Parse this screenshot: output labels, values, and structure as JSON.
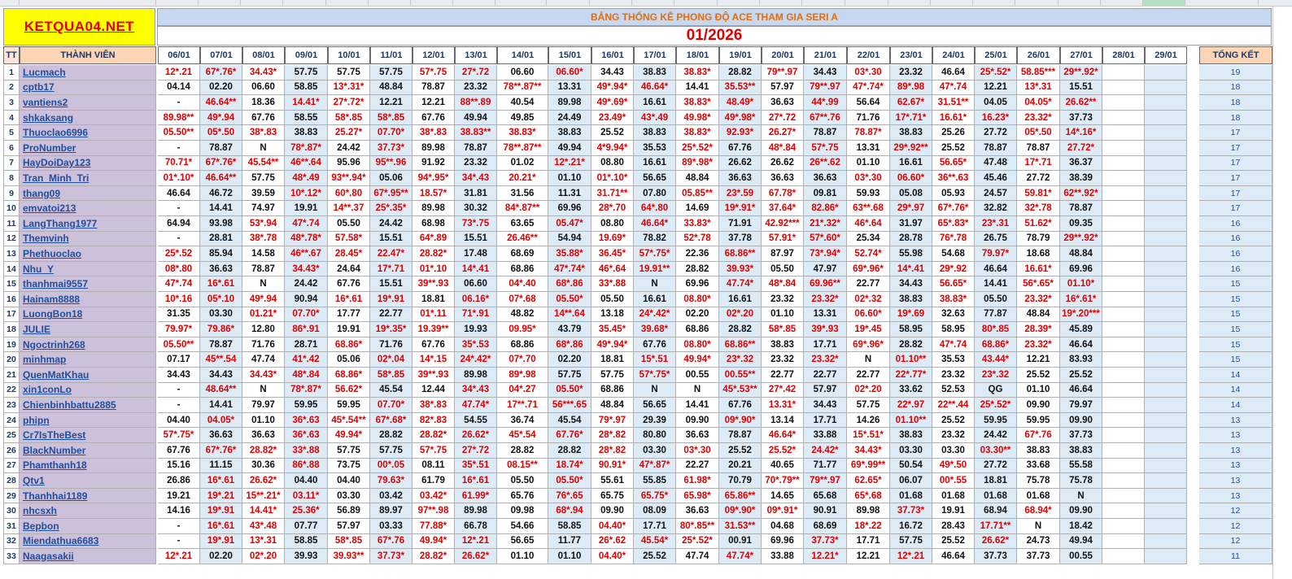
{
  "header": {
    "logo": "KETQUA04.NET",
    "subtitle": "BẢNG THỐNG KÊ PHONG ĐỘ ACE THAM GIA SERI A",
    "month": "01/2026"
  },
  "columns": {
    "tt": "TT",
    "name": "THÀNH VIÊN",
    "total": "TỔNG KẾT",
    "dates": [
      "06/01",
      "07/01",
      "08/01",
      "09/01",
      "10/01",
      "11/01",
      "12/01",
      "13/01",
      "14/01",
      "15/01",
      "16/01",
      "17/01",
      "18/01",
      "19/01",
      "20/01",
      "21/01",
      "22/01",
      "23/01",
      "24/01",
      "25/01",
      "26/01",
      "27/01",
      "28/01",
      "29/01"
    ]
  },
  "rows": [
    {
      "tt": "1",
      "name": "Lucmach",
      "values": [
        "12*.21",
        "67*.76*",
        "34.43*",
        "57.75",
        "57.75",
        "57.75",
        "57*.75",
        "27*.72",
        "06.60",
        "06.60*",
        "34.43",
        "38.83",
        "38.83*",
        "28.82",
        "79**.97",
        "34.43",
        "03*.30",
        "23.32",
        "46.64",
        "25*.52*",
        "58.85***",
        "29**.92*",
        "",
        ""
      ],
      "total": "19"
    },
    {
      "tt": "2",
      "name": "cptb17",
      "values": [
        "04.14",
        "02.20",
        "06.60",
        "58.85",
        "13*.31*",
        "48.84",
        "78.87",
        "23.32",
        "78**.87**",
        "13.31",
        "49*.94*",
        "46.64*",
        "14.41",
        "35.53**",
        "57.97",
        "79**.97",
        "47*.74*",
        "89*.98",
        "47*.74",
        "12.21",
        "13*.31",
        "15.51",
        "",
        ""
      ],
      "total": "18"
    },
    {
      "tt": "3",
      "name": "vantiens2",
      "values": [
        "-",
        "46.64**",
        "18.36",
        "14.41*",
        "27*.72*",
        "12.21",
        "12.21",
        "88**.89",
        "40.54",
        "89.98",
        "49*.69*",
        "16.61",
        "38.83*",
        "48.49*",
        "36.63",
        "44*.99",
        "56.64",
        "62.67*",
        "31.51**",
        "04.05",
        "04.05*",
        "26.62**",
        "",
        ""
      ],
      "total": "18"
    },
    {
      "tt": "4",
      "name": "shkaksang",
      "values": [
        "89.98**",
        "49*.94",
        "67.76",
        "58.55",
        "58*.85",
        "58*.85",
        "67.76",
        "49.94",
        "49.85",
        "24.49",
        "23.49*",
        "43*.49",
        "49.98*",
        "49*.98*",
        "27*.72",
        "67**.76",
        "71.76",
        "17*.71*",
        "16.61*",
        "16.23*",
        "23.32*",
        "37.73",
        "",
        ""
      ],
      "total": "18"
    },
    {
      "tt": "5",
      "name": "Thuoclao6996",
      "values": [
        "05.50**",
        "05*.50",
        "38*.83",
        "38.83",
        "25.27*",
        "07.70*",
        "38*.83",
        "38.83**",
        "38.83*",
        "38.83",
        "25.52",
        "38.83",
        "38.83*",
        "92.93*",
        "26.27*",
        "78.87",
        "78.87*",
        "38.83",
        "25.26",
        "27.72",
        "05*.50",
        "14*.16*",
        "",
        ""
      ],
      "total": "17"
    },
    {
      "tt": "6",
      "name": "ProNumber",
      "values": [
        "-",
        "78.87",
        "N",
        "78*.87*",
        "24.42",
        "37.73*",
        "89.98",
        "78.87",
        "78**.87**",
        "49.94",
        "4*9.94*",
        "35.53",
        "25*.52*",
        "67.76",
        "48*.84",
        "57*.75",
        "13.31",
        "29*.92**",
        "25.52",
        "78.87",
        "78.87",
        "27.72*",
        "",
        ""
      ],
      "total": "17"
    },
    {
      "tt": "7",
      "name": "HayDoiDay123",
      "values": [
        "70.71*",
        "67*.76*",
        "45.54**",
        "46**.64",
        "95.96",
        "95**.96",
        "91.92",
        "23.32",
        "01.02",
        "12*.21*",
        "08.80",
        "16.61",
        "89*.98*",
        "26.62",
        "26.62",
        "26**.62",
        "01.10",
        "16.61",
        "56.65*",
        "47.48",
        "17*.71",
        "36.37",
        "",
        ""
      ],
      "total": "17"
    },
    {
      "tt": "8",
      "name": "Tran_Minh_Tri",
      "values": [
        "01*.10*",
        "46.64**",
        "57.75",
        "48*.49",
        "93**.94*",
        "05.06",
        "94*.95*",
        "34*.43",
        "20.21*",
        "01.10",
        "01*.10*",
        "56.65",
        "48.84",
        "36.63",
        "36.63",
        "36.63",
        "03*.30",
        "06.60*",
        "36**.63",
        "45.46",
        "27.72",
        "38.39",
        "",
        ""
      ],
      "total": "17"
    },
    {
      "tt": "9",
      "name": "thang09",
      "values": [
        "46.64",
        "46.72",
        "39.59",
        "10*.12*",
        "60*.80",
        "67*.95**",
        "18.57*",
        "31.81",
        "31.56",
        "11.31",
        "31.71**",
        "07.80",
        "05.85**",
        "23*.59",
        "67.78*",
        "09.81",
        "59.93",
        "05.08",
        "05.93",
        "24.57",
        "59.81*",
        "62**.92*",
        "",
        ""
      ],
      "total": "17"
    },
    {
      "tt": "10",
      "name": "emvatoi213",
      "values": [
        "-",
        "14.41",
        "74.97",
        "19.91",
        "14**.37",
        "25*.35*",
        "89.98",
        "30.32",
        "84*.87**",
        "69.96",
        "28*.70",
        "64*.80",
        "14.69",
        "19*.91*",
        "37.64*",
        "82.86*",
        "63**.68",
        "29*.97",
        "67*.76*",
        "32.82",
        "32*.78",
        "78.87",
        "",
        ""
      ],
      "total": "17"
    },
    {
      "tt": "11",
      "name": "LangThang1977",
      "values": [
        "64.94",
        "93.98",
        "53*.94",
        "47*.74",
        "05.50",
        "24.42",
        "68.98",
        "73*.75",
        "63.65",
        "05.47*",
        "08.80",
        "46.64*",
        "33.83*",
        "71.91",
        "42.92***",
        "21*.32*",
        "46*.64",
        "31.97",
        "65*.83*",
        "23*.31",
        "51.62*",
        "09.35",
        "",
        ""
      ],
      "total": "16"
    },
    {
      "tt": "12",
      "name": "Themvinh",
      "values": [
        "-",
        "28.81",
        "38*.78",
        "48*.78*",
        "57.58*",
        "15.51",
        "64*.89",
        "15.51",
        "26.46**",
        "54.94",
        "19.69*",
        "78.82",
        "52*.78",
        "37.78",
        "57.91*",
        "57*.60*",
        "25.34",
        "28.78",
        "76*.78",
        "26.75",
        "78.79",
        "29**.92*",
        "",
        ""
      ],
      "total": "16"
    },
    {
      "tt": "13",
      "name": "Phethuoclao",
      "values": [
        "25*.52",
        "85.94",
        "14.58",
        "46**.67",
        "28.45*",
        "22.47*",
        "28.82*",
        "17.48",
        "68.69",
        "35.88*",
        "36.45*",
        "57*.75*",
        "22.36",
        "68.86**",
        "87.97",
        "73*.94*",
        "52.74*",
        "55.98",
        "54.68",
        "79.97*",
        "18.68",
        "48.84",
        "",
        ""
      ],
      "total": "16"
    },
    {
      "tt": "14",
      "name": "Nhu_Y",
      "values": [
        "08*.80",
        "36.63",
        "78.87",
        "34.43*",
        "24.64",
        "17*.71",
        "01*.10",
        "14*.41",
        "68.86",
        "47*.74*",
        "46*.64",
        "19.91**",
        "28.82",
        "39.93*",
        "05.50",
        "47.97",
        "69*.96*",
        "14*.41",
        "29*.92",
        "46.64",
        "16.61*",
        "69.96",
        "",
        ""
      ],
      "total": "16"
    },
    {
      "tt": "15",
      "name": "thanhmai9557",
      "values": [
        "47*.74",
        "16*.61",
        "N",
        "24.42",
        "67.76",
        "15.51",
        "39**.93",
        "06.60",
        "04*.40",
        "68*.86",
        "33*.88",
        "N",
        "69.96",
        "47.74*",
        "48*.84",
        "69.96**",
        "22.77",
        "34.43",
        "56.65*",
        "14.41",
        "56*.65*",
        "01.10*",
        "",
        ""
      ],
      "total": "15"
    },
    {
      "tt": "16",
      "name": "Hainam8888",
      "values": [
        "10*.16",
        "05*.10",
        "49*.94",
        "90.94",
        "16*.61",
        "19*.91",
        "18.81",
        "06.16*",
        "07*.68",
        "05.50*",
        "05.50",
        "16.61",
        "08.80*",
        "16.61",
        "23.32",
        "23.32*",
        "02*.32",
        "38.83",
        "38.83*",
        "05.50",
        "23.32*",
        "16*.61*",
        "",
        ""
      ],
      "total": "15"
    },
    {
      "tt": "17",
      "name": "LuongBon18",
      "values": [
        "31.35",
        "03.30",
        "01.21*",
        "07.70*",
        "17.77",
        "22.77",
        "01*.11",
        "71*.91",
        "48.82",
        "14**.64",
        "13.18",
        "24*.42*",
        "02.20",
        "02*.20",
        "01.10",
        "13.31",
        "06.60*",
        "19*.69",
        "32.63",
        "77.87",
        "48.84",
        "19*.20***",
        "",
        ""
      ],
      "total": "15"
    },
    {
      "tt": "18",
      "name": "JULIE",
      "values": [
        "79.97*",
        "79.86*",
        "12.80",
        "86*.91",
        "19.91",
        "19*.35*",
        "19.39**",
        "19.93",
        "09.95*",
        "43.79",
        "35.45*",
        "39.68*",
        "68.86",
        "28.82",
        "58*.85",
        "39*.93",
        "19*.45",
        "58.95",
        "58.95",
        "80*.85",
        "28.39*",
        "45.89",
        "",
        ""
      ],
      "total": "15"
    },
    {
      "tt": "19",
      "name": "Ngoctrinh268",
      "values": [
        "05.50**",
        "78.87",
        "71.76",
        "28.71",
        "68.86*",
        "71.76",
        "67.76",
        "35*.53",
        "68.86",
        "68*.86",
        "49*.94*",
        "67.76",
        "08.80*",
        "68.86**",
        "38.83",
        "17.71",
        "69*.96*",
        "28.82",
        "47*.74",
        "68.86*",
        "23.32*",
        "46.64",
        "",
        ""
      ],
      "total": "15"
    },
    {
      "tt": "20",
      "name": "minhmap",
      "values": [
        "07.17",
        "45**.54",
        "47.74",
        "41*.42",
        "05.06",
        "02*.04",
        "14*.15",
        "24*.42*",
        "07*.70",
        "02.20",
        "18.81",
        "15*.51",
        "49.94*",
        "23*.32",
        "23.32",
        "23.32*",
        "N",
        "01.10**",
        "35.53",
        "43.44*",
        "12.21",
        "83.93",
        "",
        ""
      ],
      "total": "15"
    },
    {
      "tt": "21",
      "name": "QuenMatKhau",
      "values": [
        "34.43",
        "34.43",
        "34.43*",
        "48*.84",
        "68.86*",
        "58*.85",
        "39**.93",
        "89.98",
        "89*.98",
        "57.75",
        "57.75",
        "57*.75*",
        "00.55",
        "00.55**",
        "22.77",
        "22.77",
        "22.77",
        "22*.77*",
        "23.32",
        "23*.32",
        "25.52",
        "25.52",
        "",
        ""
      ],
      "total": "14"
    },
    {
      "tt": "22",
      "name": "xin1conLo",
      "values": [
        "-",
        "48.64**",
        "N",
        "78*.87*",
        "56.62*",
        "45.54",
        "12.44",
        "34*.43",
        "04*.27",
        "05.50*",
        "68.86",
        "N",
        "N",
        "45*.53**",
        "27*.42",
        "57.97",
        "02*.20",
        "33.62",
        "52.53",
        "QG",
        "01.10",
        "46.64",
        "",
        ""
      ],
      "total": "14"
    },
    {
      "tt": "23",
      "name": "Chienbinhbattu2885",
      "values": [
        "-",
        "14.41",
        "79.97",
        "59.95",
        "59.95",
        "07.70*",
        "38*.83",
        "47.74*",
        "17**.71",
        "56***.65",
        "48.84",
        "56.65",
        "14.41",
        "67.76",
        "13.31*",
        "34.43",
        "57.75",
        "22*.97",
        "22**.44",
        "25*.52*",
        "09.90",
        "79.97",
        "",
        ""
      ],
      "total": "14"
    },
    {
      "tt": "24",
      "name": "phipn",
      "values": [
        "04.40",
        "04.05*",
        "01.10",
        "36*.63",
        "45*.54**",
        "67*.68*",
        "82*.83",
        "54.55",
        "36.74",
        "45.54",
        "79*.97",
        "29.39",
        "09.90",
        "09*.90*",
        "13.14",
        "17.71",
        "14.26",
        "01.10**",
        "25.52",
        "59.95",
        "59.95",
        "09.90",
        "",
        ""
      ],
      "total": "13"
    },
    {
      "tt": "25",
      "name": "Cr7IsTheBest",
      "values": [
        "57*.75*",
        "36.63",
        "36.63",
        "36*.63",
        "49.94*",
        "28.82",
        "28.82*",
        "26.62*",
        "45*.54",
        "67.76*",
        "28*.82",
        "80.80",
        "36.63",
        "78.87",
        "46.64*",
        "33.88",
        "15*.51*",
        "38.83",
        "23.32",
        "24.42",
        "67*.76",
        "37.73",
        "",
        ""
      ],
      "total": "13"
    },
    {
      "tt": "26",
      "name": "BlackNumber",
      "values": [
        "67.76",
        "67*.76*",
        "28.82*",
        "33*.88",
        "57.75",
        "57.75",
        "57*.75",
        "27*.72",
        "28.82",
        "28.82",
        "28*.82",
        "03.30",
        "03*.30",
        "25.52",
        "25.52*",
        "24.42*",
        "34.43*",
        "03.30",
        "03.30",
        "03.30**",
        "38.83",
        "38.83",
        "",
        ""
      ],
      "total": "13"
    },
    {
      "tt": "27",
      "name": "Phamthanh18",
      "values": [
        "15.16",
        "11.15",
        "30.36",
        "86*.88",
        "73.75",
        "00*.05",
        "08.11",
        "35*.51",
        "08.15**",
        "18.74*",
        "90.91*",
        "47*.87*",
        "22.27",
        "20.21",
        "40.65",
        "71.77",
        "69*.99**",
        "50.54",
        "49*.50",
        "27.72",
        "33.68",
        "55.58",
        "",
        ""
      ],
      "total": "13"
    },
    {
      "tt": "28",
      "name": "Qtv1",
      "values": [
        "26.86",
        "16*.61",
        "26.62*",
        "04.40",
        "04.40",
        "79.63*",
        "61.79",
        "16*.61",
        "05.50",
        "05.50*",
        "55.61",
        "55.85",
        "61.98*",
        "70.79",
        "70*.79**",
        "79**.97",
        "62.65*",
        "06.07",
        "00*.55",
        "18.81",
        "75.78",
        "75.78",
        "",
        ""
      ],
      "total": "13"
    },
    {
      "tt": "29",
      "name": "Thanhhai1189",
      "values": [
        "19.21",
        "19*.21",
        "15**.21*",
        "03.11*",
        "03.30",
        "03.42",
        "03.42*",
        "61.99*",
        "65.76",
        "76*.65",
        "65.75",
        "65.75*",
        "65.98*",
        "65.86**",
        "14.65",
        "65.68",
        "65*.68",
        "01.68",
        "01.68",
        "01.68",
        "01.68",
        "N",
        "",
        ""
      ],
      "total": "13"
    },
    {
      "tt": "30",
      "name": "nhcsxh",
      "values": [
        "14.16",
        "19*.91",
        "14.41*",
        "25.36*",
        "56.89",
        "89.97",
        "97**.98",
        "89.98",
        "09.98",
        "68*.94",
        "09.90",
        "08.09",
        "36.63",
        "09*.90*",
        "09*.91*",
        "90.91",
        "89.98",
        "37.73*",
        "19.91",
        "68.94",
        "68.94*",
        "09.90",
        "",
        ""
      ],
      "total": "12"
    },
    {
      "tt": "31",
      "name": "Bepbon",
      "values": [
        "-",
        "16*.61",
        "43*.48",
        "07.77",
        "57.97",
        "03.33",
        "77.88*",
        "66.78",
        "54.66",
        "58.85",
        "04.40*",
        "17.71",
        "80*.85**",
        "31.53**",
        "04.68",
        "68.69",
        "18*.22",
        "16.72",
        "28.43",
        "17.71**",
        "N",
        "18.42",
        "",
        ""
      ],
      "total": "12"
    },
    {
      "tt": "32",
      "name": "Miendathua6683",
      "values": [
        "-",
        "19*.91",
        "13*.31",
        "58.85",
        "58*.85",
        "67*.76",
        "49.94*",
        "12*.21",
        "56.65",
        "11.77",
        "26*.62",
        "45.54*",
        "25*.52*",
        "00.91",
        "69.96",
        "37.73*",
        "17.71",
        "57.75",
        "25.52",
        "26.62*",
        "24.73",
        "49.94",
        "",
        ""
      ],
      "total": "12"
    },
    {
      "tt": "33",
      "name": "Naagasakii",
      "values": [
        "12*.21",
        "02.20",
        "02*.20",
        "39.93",
        "39.93**",
        "37.73*",
        "28.82*",
        "26.62*",
        "01.10",
        "01.10",
        "04.40*",
        "25.52",
        "47.74",
        "47.74*",
        "33.88",
        "12.21*",
        "12.21",
        "12*.21",
        "46.64",
        "37.73",
        "37.73",
        "00.55",
        "",
        ""
      ],
      "total": "11"
    }
  ],
  "colors": {
    "accent": "#e00000",
    "name_bg": "#ccc0da",
    "header_bg": "#c6d9f1",
    "logo_bg": "#ffff00",
    "alt_bg": "#ddebf7"
  }
}
